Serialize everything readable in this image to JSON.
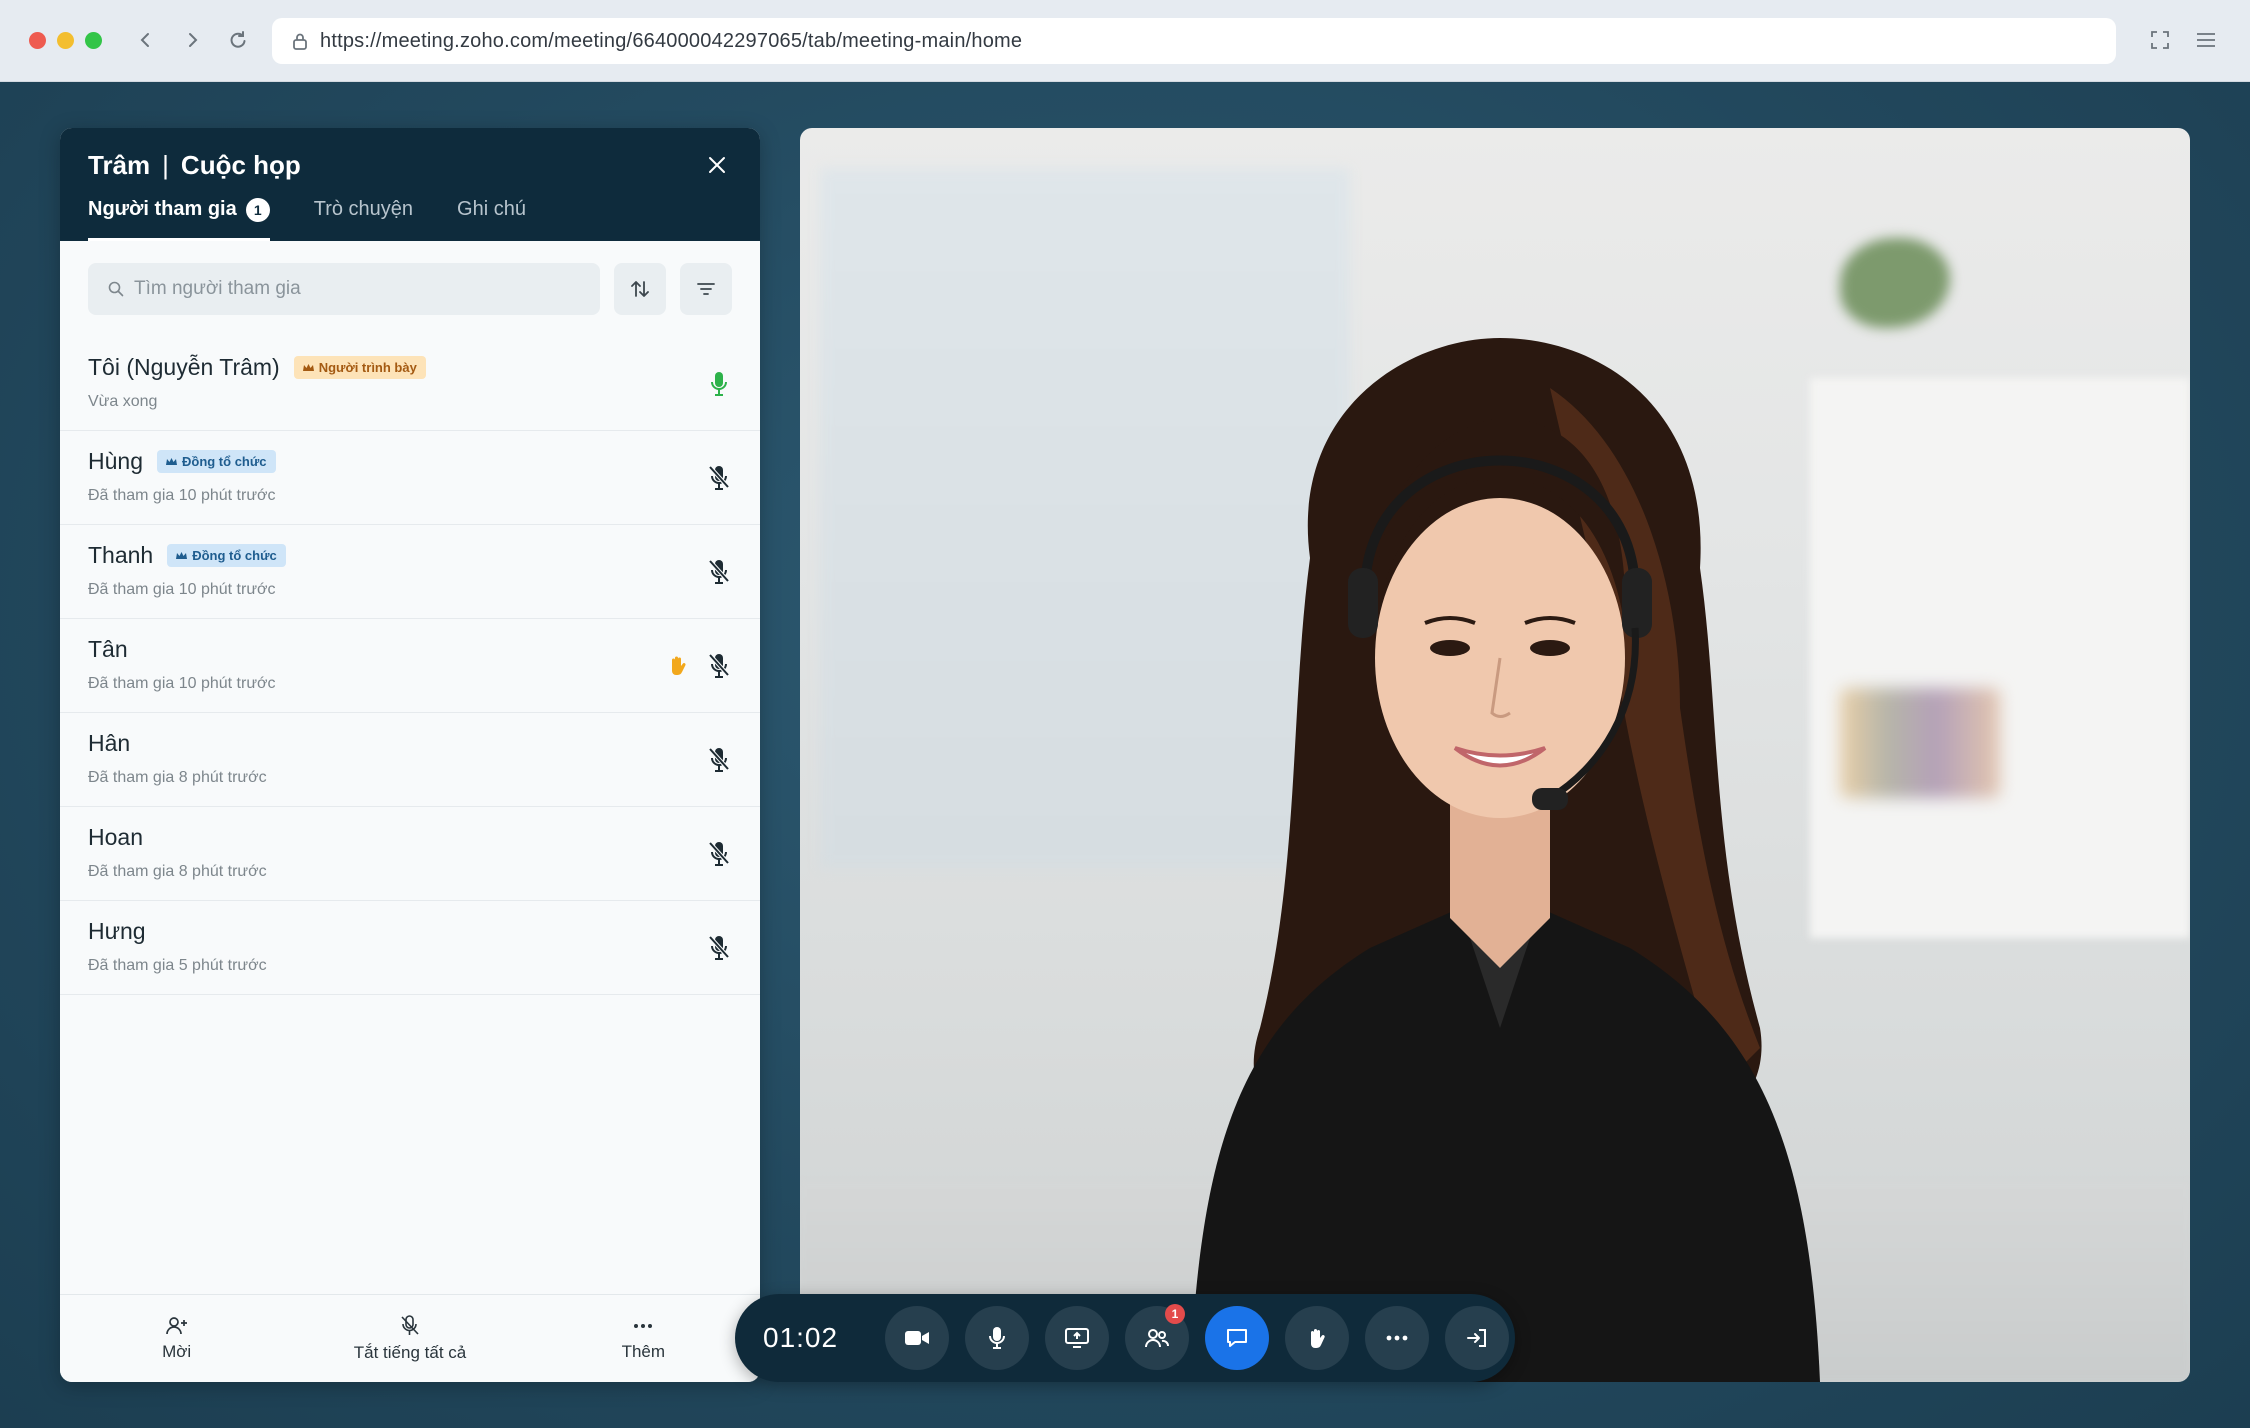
{
  "browser": {
    "url": "https://meeting.zoho.com/meeting/664000042297065/tab/meeting-main/home"
  },
  "panel": {
    "user": "Trâm",
    "separator": "|",
    "meeting": "Cuộc họp",
    "tabs": [
      {
        "label": "Người tham gia",
        "badge": "1"
      },
      {
        "label": "Trò chuyện"
      },
      {
        "label": "Ghi chú"
      }
    ],
    "search_placeholder": "Tìm người tham gia",
    "participants": [
      {
        "name": "Tôi (Nguyễn Trâm)",
        "role": "Người trình bày",
        "status": "Vừa xong",
        "mic": "on",
        "hand_raised": false
      },
      {
        "name": "Hùng",
        "role": "Đồng tổ chức",
        "status": "Đã tham gia 10 phút trước",
        "mic": "muted",
        "hand_raised": false
      },
      {
        "name": "Thanh",
        "role": "Đồng tổ chức",
        "status": "Đã tham gia 10 phút trước",
        "mic": "muted",
        "hand_raised": false
      },
      {
        "name": "Tân",
        "role": "",
        "status": "Đã tham gia 10 phút trước",
        "mic": "muted",
        "hand_raised": true
      },
      {
        "name": "Hân",
        "role": "",
        "status": "Đã tham gia 8 phút trước",
        "mic": "muted",
        "hand_raised": false
      },
      {
        "name": "Hoan",
        "role": "",
        "status": "Đã tham gia 8 phút trước",
        "mic": "muted",
        "hand_raised": false
      },
      {
        "name": "Hưng",
        "role": "",
        "status": "Đã tham gia 5 phút trước",
        "mic": "muted",
        "hand_raised": false
      }
    ],
    "footer": {
      "invite": "Mời",
      "mute_all": "Tắt tiếng tất cả",
      "more": "Thêm"
    }
  },
  "controls": {
    "timer": "01:02",
    "participants_badge": "1"
  },
  "colors": {
    "panel_header": "#0e2b3c",
    "accent_blue": "#1a73e8",
    "mic_on": "#2db24a",
    "hand": "#f2a81d",
    "badge_red": "#e34b4b"
  }
}
